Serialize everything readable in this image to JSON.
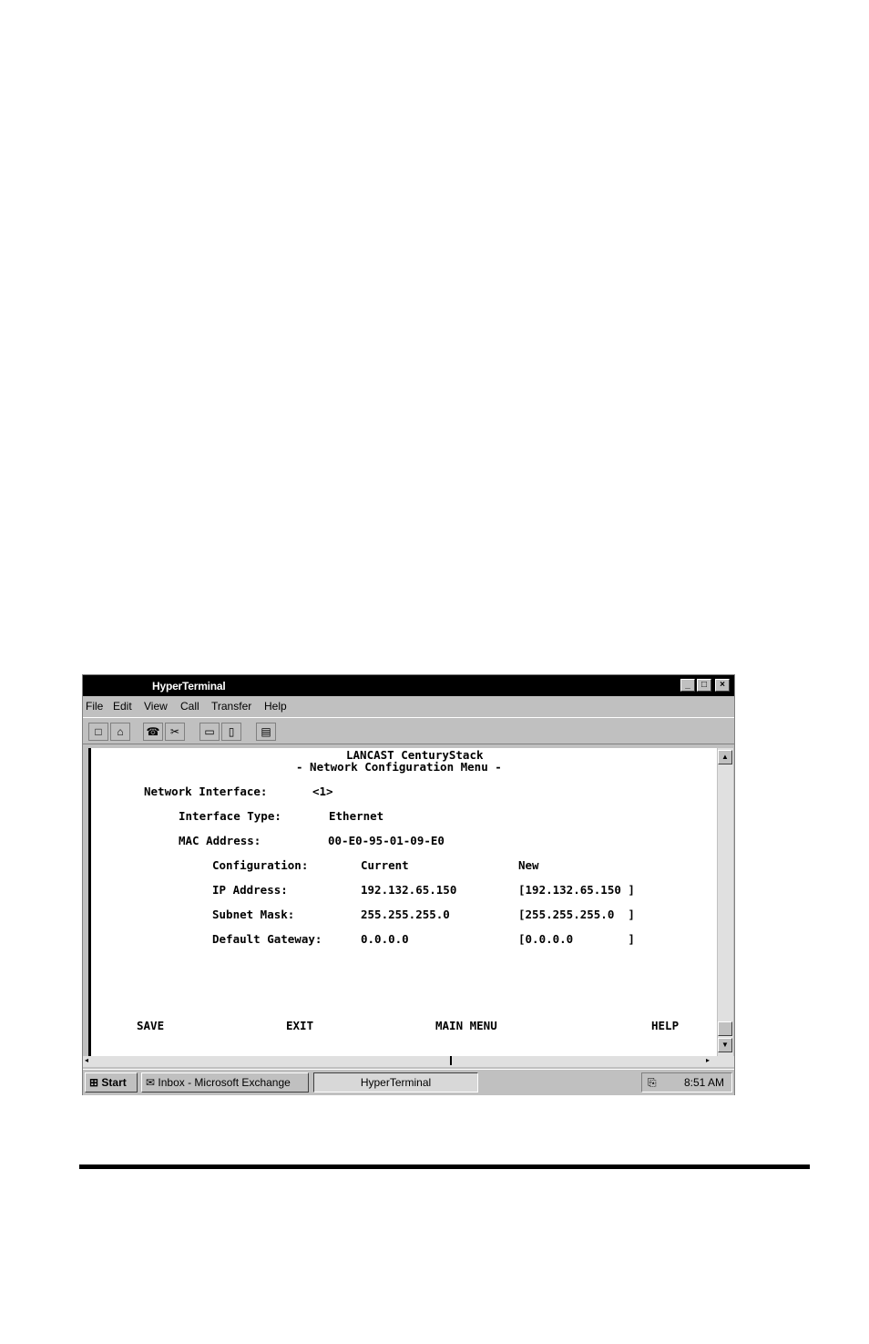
{
  "window": {
    "title": "HyperTerminal",
    "controls": {
      "minimize": "_",
      "maximize": "□",
      "close": "×"
    }
  },
  "menu": [
    "File",
    "Edit",
    "View",
    "Call",
    "Transfer",
    "Help"
  ],
  "toolbar_icons": [
    "new-icon",
    "open-icon",
    "connect-icon",
    "disconnect-icon",
    "send-icon",
    "receive-icon",
    "properties-icon"
  ],
  "terminal": {
    "product": "LANCAST CenturyStack",
    "menu_title": "- Network Configuration Menu -",
    "network_interface_label": "Network Interface:",
    "network_interface_value": "<1>",
    "interface_type_label": "Interface Type:",
    "interface_type_value": "Ethernet",
    "mac_label": "MAC Address:",
    "mac_value": "00-E0-95-01-09-E0",
    "config_label": "Configuration:",
    "current_header": "Current",
    "new_header": "New",
    "rows": [
      {
        "label": "IP Address:",
        "current": "192.132.65.150",
        "new": "[192.132.65.150 ]"
      },
      {
        "label": "Subnet Mask:",
        "current": "255.255.255.0",
        "new": "[255.255.255.0  ]"
      },
      {
        "label": "Default Gateway:",
        "current": "0.0.0.0",
        "new": "[0.0.0.0        ]"
      }
    ],
    "commands": [
      "SAVE",
      "EXIT",
      "MAIN MENU",
      "HELP"
    ]
  },
  "taskbar": {
    "start": "Start",
    "tasks": [
      "Inbox - Microsoft Exchange",
      "HyperTerminal"
    ],
    "clock": "8:51 AM"
  }
}
